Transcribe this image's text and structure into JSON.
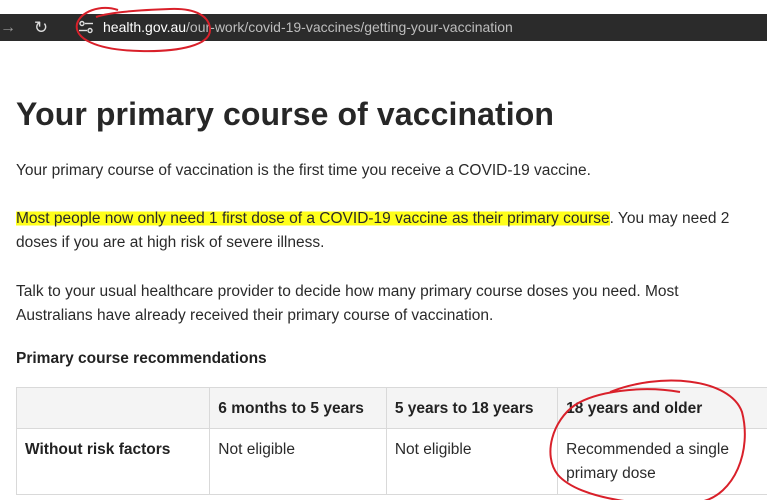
{
  "browser": {
    "forward_icon": "arrow-right",
    "reload_icon": "reload",
    "site_info_icon": "tune",
    "url_host": "health.gov.au",
    "url_path": "/our-work/covid-19-vaccines/getting-your-vaccination"
  },
  "page": {
    "title": "Your primary course of vaccination",
    "intro": "Your primary course of vaccination is the first time you receive a COVID-19 vaccine.",
    "para2_highlighted": "Most people now only need 1 first dose of a COVID-19 vaccine as their primary course",
    "para2_rest": ". You may need 2 doses if you are at high risk of severe illness.",
    "para3": "Talk to your usual healthcare provider to decide how many primary course doses you need. Most Australians have already received their primary course of vaccination.",
    "section_heading": "Primary course recommendations"
  },
  "table": {
    "headers": [
      "",
      "6 months to 5 years",
      "5 years to 18 years",
      "18 years and older"
    ],
    "rows": [
      {
        "label": "Without risk factors",
        "cells": [
          "Not eligible",
          "Not eligible",
          "Recommended a single primary dose"
        ]
      }
    ]
  },
  "annotations": {
    "highlight_color": "#ffff1a",
    "circle_color": "#d9202a"
  }
}
